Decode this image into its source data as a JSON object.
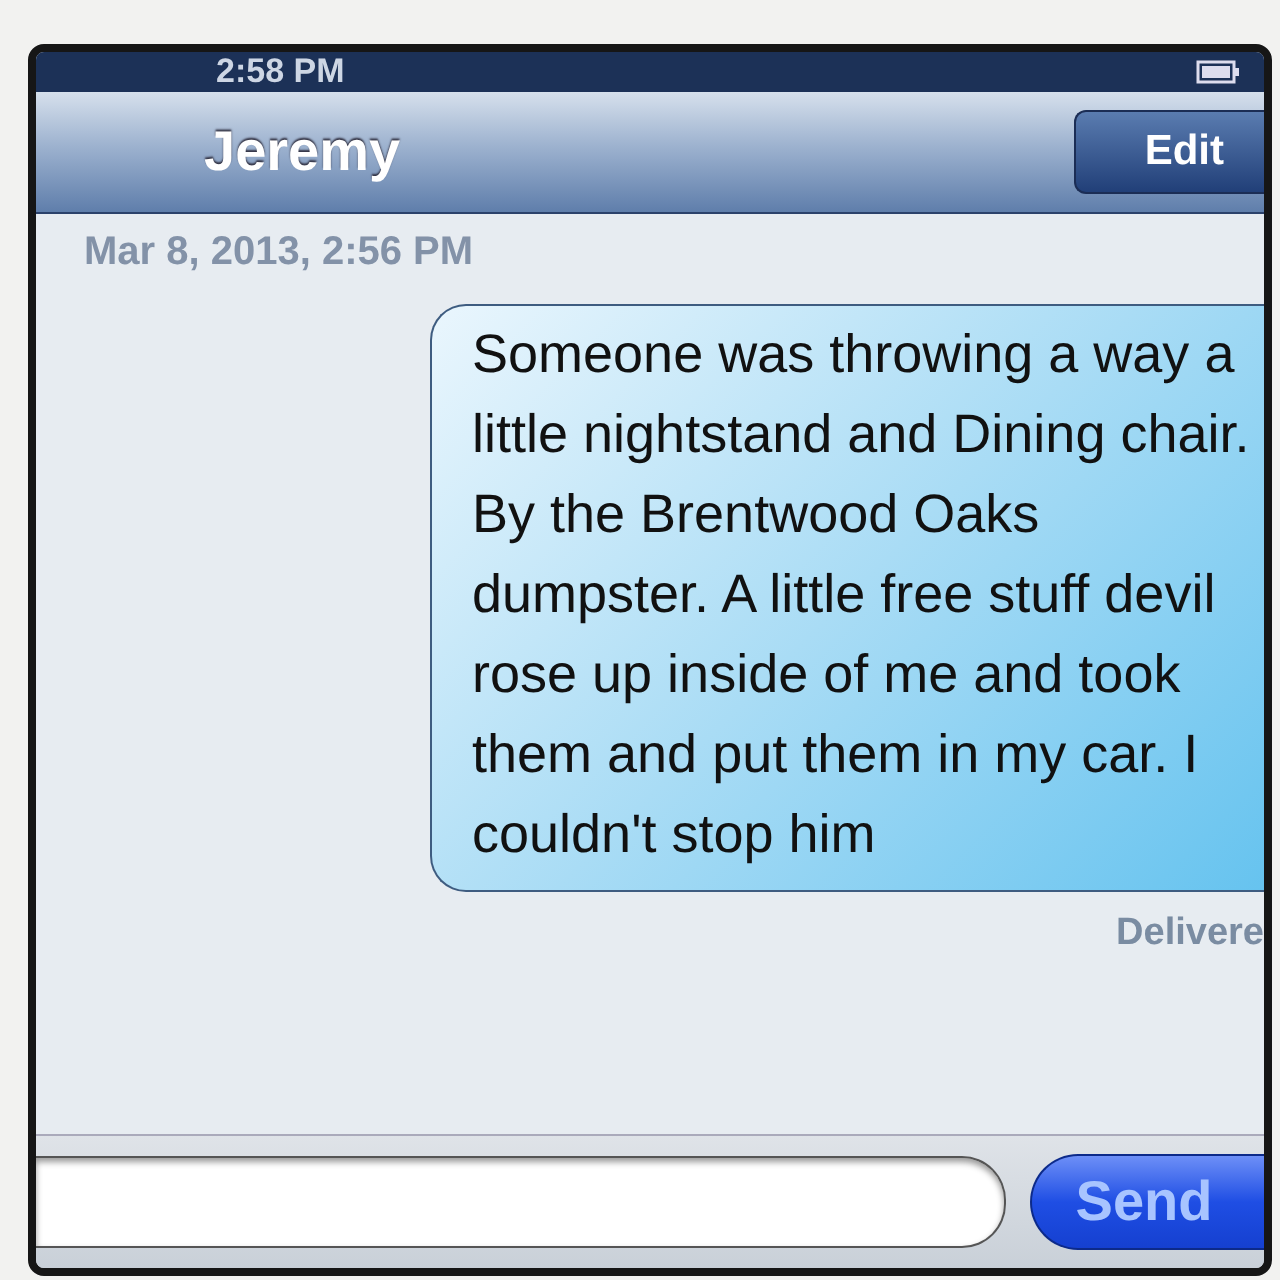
{
  "status_bar": {
    "time": "2:58 PM"
  },
  "nav_bar": {
    "title": "Jeremy",
    "edit_button": "Edit"
  },
  "timestamp": "Mar 8, 2013, 2:56 PM",
  "messages": [
    {
      "text": "Someone was throwing a way a little nightstand and Dining chair. By the Brentwood Oaks dumpster. A little free stuff devil rose up inside of me and took them and put them in my car. I couldn't stop him",
      "status": "Delivere"
    }
  ],
  "composer": {
    "send_button": "Send"
  }
}
